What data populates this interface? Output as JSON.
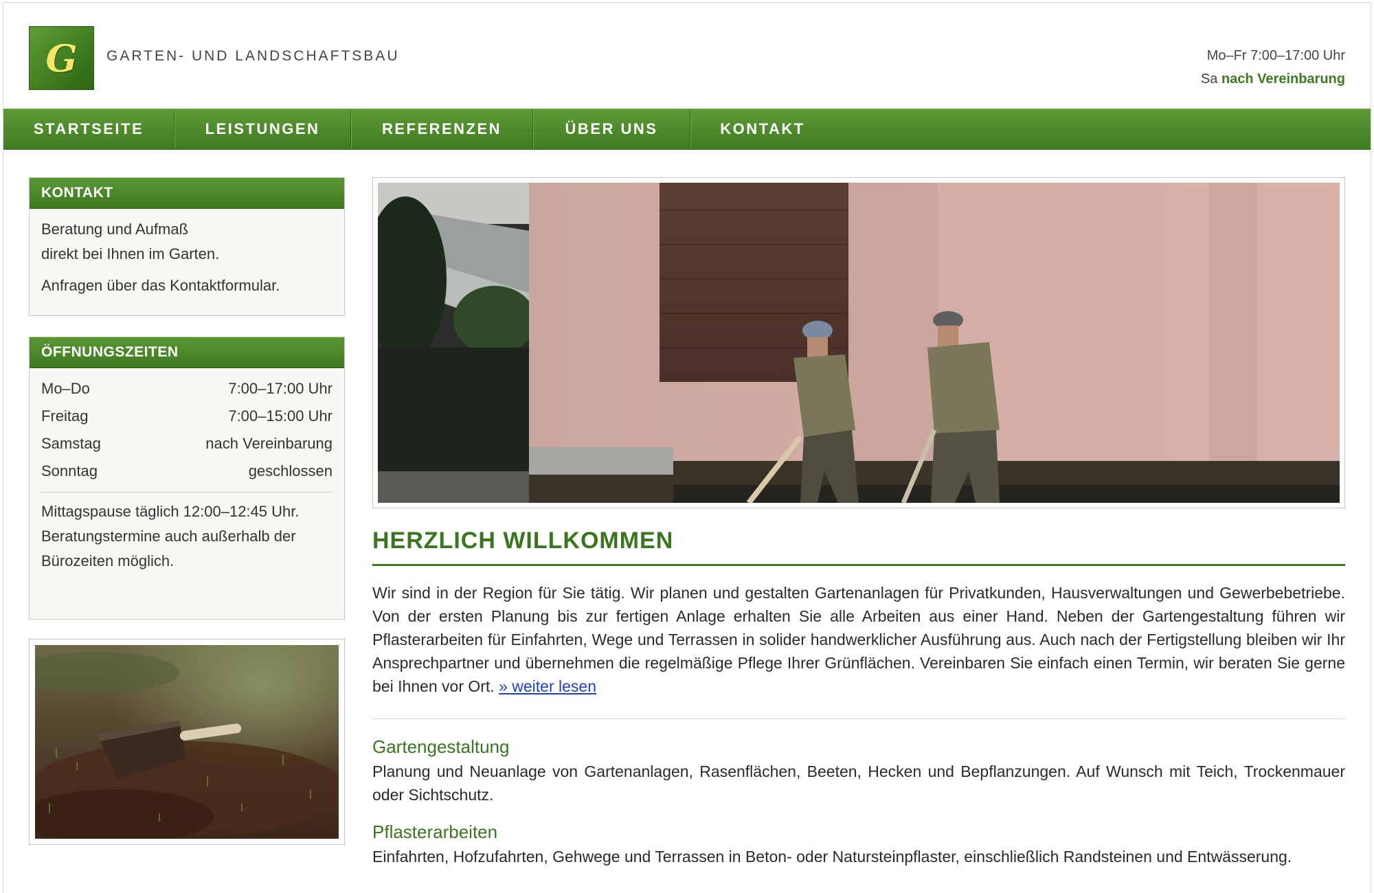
{
  "header": {
    "logo_letter": "G",
    "company_name": "GARTEN- UND LANDSCHAFTSBAU",
    "hours_line1": "Mo–Fr 7:00–17:00 Uhr",
    "hours_line2_prefix": "Sa",
    "hours_line2_highlight": "nach Vereinbarung"
  },
  "nav": {
    "items": [
      "STARTSEITE",
      "LEISTUNGEN",
      "REFERENZEN",
      "ÜBER UNS",
      "KONTAKT"
    ]
  },
  "sidebar": {
    "contact": {
      "title": "KONTAKT",
      "line1": "Beratung und Aufmaß",
      "line2": "direkt bei Ihnen im Garten.",
      "line3": "Anfragen über das Kontaktformular."
    },
    "hours": {
      "title": "ÖFFNUNGSZEITEN",
      "rows": [
        {
          "day": "Mo–Do",
          "time": "7:00–17:00 Uhr"
        },
        {
          "day": "Freitag",
          "time": "7:00–15:00 Uhr"
        },
        {
          "day": "Samstag",
          "time": "nach Vereinbarung"
        },
        {
          "day": "Sonntag",
          "time": "geschlossen"
        }
      ],
      "note1": "Mittagspause täglich 12:00–12:45 Uhr.",
      "note2": "Beratungstermine auch außerhalb der Bürozeiten möglich."
    }
  },
  "main": {
    "title": "HERZLICH WILLKOMMEN",
    "intro": "Wir sind in der Region für Sie tätig. Wir planen und gestalten Gartenanlagen für Privatkunden, Hausverwaltungen und Gewerbebetriebe. Von der ersten Planung bis zur fertigen Anlage erhalten Sie alle Arbeiten aus einer Hand. Neben der Gartengestaltung führen wir Pflasterarbeiten für Einfahrten, Wege und Terrassen in solider handwerklicher Ausführung aus. Auch nach der Fertigstellung bleiben wir Ihr Ansprechpartner und übernehmen die regelmäßige Pflege Ihrer Grünflächen. Vereinbaren Sie einfach einen Termin, wir beraten Sie gerne bei Ihnen vor Ort.",
    "read_more": "» weiter lesen",
    "sections": [
      {
        "title": "Gartengestaltung",
        "text": "Planung und Neuanlage von Gartenanlagen, Rasenflächen, Beeten, Hecken und Bepflanzungen. Auf Wunsch mit Teich, Trockenmauer oder Sichtschutz."
      },
      {
        "title": "Pflasterarbeiten",
        "text": "Einfahrten, Hofzufahrten, Gehwege und Terrassen in Beton- oder Natursteinpflaster, einschließlich Randsteinen und Entwässerung."
      }
    ]
  },
  "colors": {
    "brand_green": "#3e7c22",
    "link_blue": "#1f3fc9",
    "logo_letter": "#f2e66a"
  }
}
